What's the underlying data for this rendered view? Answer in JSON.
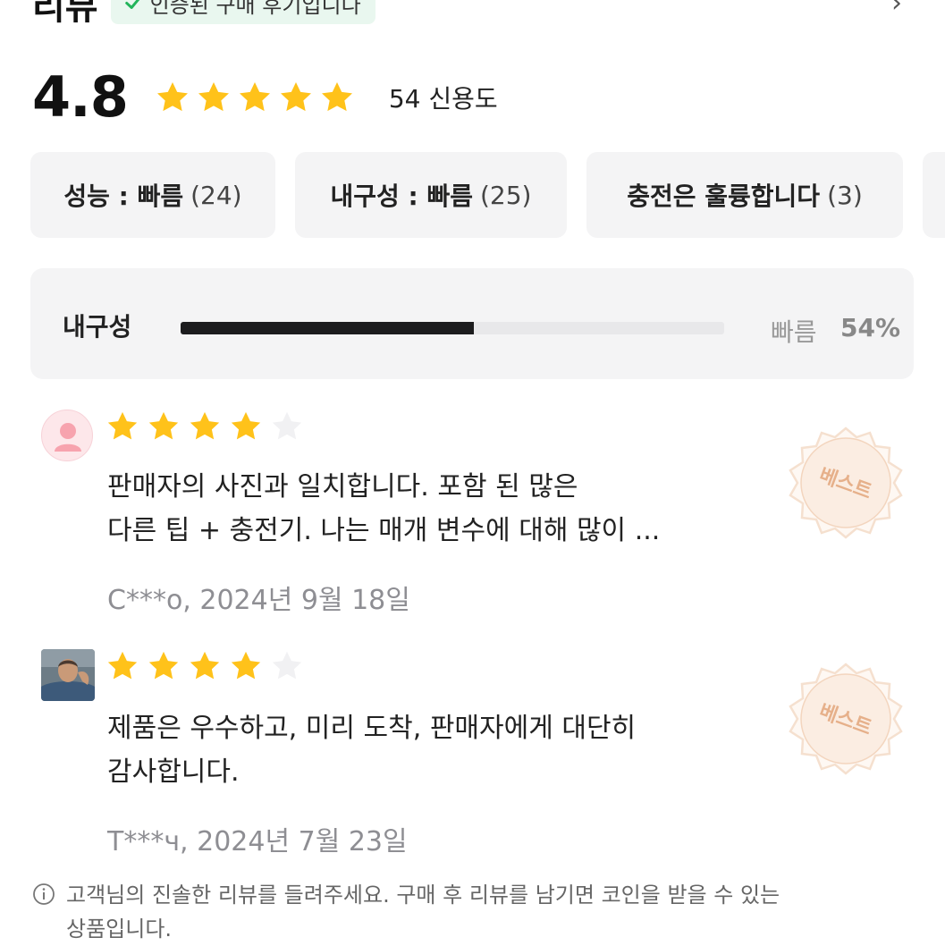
{
  "header": {
    "title": "리뷰",
    "verified_text": "인증된 구매 후기입니다"
  },
  "rating": {
    "score": "4.8",
    "stars": 5,
    "count_text": "54 신용도"
  },
  "chips": [
    {
      "label": "성능 : 빠름",
      "count": "(24)"
    },
    {
      "label": "내구성 : 빠름",
      "count": "(25)"
    },
    {
      "label": "충전은 훌륭합니다",
      "count": "(3)"
    }
  ],
  "attribute_bar": {
    "label": "내구성",
    "value_label": "빠름",
    "percent_text": "54%",
    "fraction": 0.54
  },
  "reviews": [
    {
      "avatar": "default-avatar",
      "stars": 4,
      "text_line1": "판매자의 사진과 일치합니다. 포함 된 많은",
      "text_line2": "다른 팁 + 충전기. 나는 매개 변수에 대해 많이 ...",
      "meta": "C***o, 2024년 9월 18일",
      "badge": "베스트"
    },
    {
      "avatar": "user-photo",
      "stars": 4,
      "text_line1": "제품은 우수하고, 미리 도착, 판매자에게 대단히",
      "text_line2": "감사합니다.",
      "meta": "T***ч, 2024년 7월 23일",
      "badge": "베스트"
    }
  ],
  "footer": {
    "note_line1": "고객님의 진솔한 리뷰를 들려주세요. 구매 후 리뷰를 남기면 코인을 받을 수 있는",
    "note_line2": "상품입니다."
  },
  "colors": {
    "star": "#FFC21A",
    "star_empty": "#F1F1F3",
    "bar_fill": "#1C1C1E",
    "verified_bg": "#E9F7EF",
    "verified_check": "#22B45A",
    "badge": "#F3C9A8"
  }
}
